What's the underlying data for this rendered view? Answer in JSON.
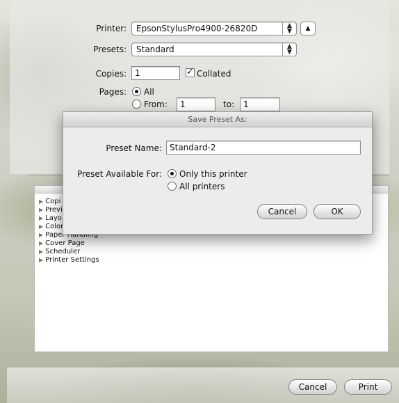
{
  "print_sheet": {
    "printer_label": "Printer:",
    "printer_value": "EpsonStylusPro4900-26820D",
    "presets_label": "Presets:",
    "presets_value": "Standard",
    "copies_label": "Copies:",
    "copies_value": "1",
    "collated_label": "Collated",
    "collated_checked": true,
    "pages_label": "Pages:",
    "pages_all_label": "All",
    "pages_from_label": "From:",
    "pages_from_value": "1",
    "pages_to_label": "to:",
    "pages_to_value": "1"
  },
  "panel_list": {
    "items": [
      {
        "label": "Copi"
      },
      {
        "label": "Previ"
      },
      {
        "label": "Layo"
      },
      {
        "label": "Color Matching"
      },
      {
        "label": "Paper Handling"
      },
      {
        "label": "Cover Page"
      },
      {
        "label": "Scheduler"
      },
      {
        "label": "Printer Settings"
      }
    ]
  },
  "dialog": {
    "title": "Save Preset As:",
    "preset_name_label": "Preset Name:",
    "preset_name_value": "Standard-2",
    "available_for_label": "Preset Available For:",
    "option_only_this": "Only this printer",
    "option_all_printers": "All printers",
    "selected_option": "Only this printer",
    "cancel_label": "Cancel",
    "ok_label": "OK"
  },
  "footer": {
    "cancel_label": "Cancel",
    "print_label": "Print"
  },
  "icons": {
    "popup_arrows": "updown-arrows-icon",
    "disclosure": "disclosure-triangle-up-icon",
    "list_triangle": "disclosure-triangle-right-icon"
  }
}
